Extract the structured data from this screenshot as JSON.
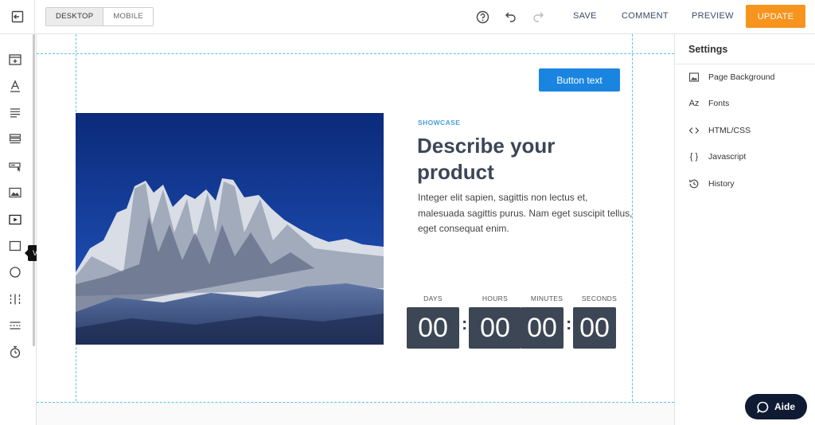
{
  "topbar": {
    "device_desktop": "DESKTOP",
    "device_mobile": "MOBILE",
    "save": "SAVE",
    "comment": "COMMENT",
    "preview": "PREVIEW",
    "update": "UPDATE"
  },
  "leftbar": {
    "tools": [
      "section-add-icon",
      "text-icon",
      "paragraph-icon",
      "list-icon",
      "form-icon",
      "image-icon",
      "video-icon",
      "box-icon",
      "circle-icon",
      "columns-icon",
      "divider-icon",
      "timer-icon"
    ],
    "tooltip": "Video"
  },
  "canvas": {
    "button_text": "Button text",
    "eyebrow": "SHOWCASE",
    "headline": "Describe your product",
    "body": "Integer elit sapien, sagittis non lectus et, malesuada sagittis purus. Nam eget suscipit tellus, eget consequat enim.",
    "countdown": {
      "days_label": "DAYS",
      "hours_label": "HOURS",
      "minutes_label": "MINUTES",
      "seconds_label": "SECONDS",
      "days": "00",
      "hours": "00",
      "minutes": "00",
      "seconds": "00",
      "separator": ":"
    }
  },
  "settings": {
    "title": "Settings",
    "items": [
      "Page Background",
      "Fonts",
      "HTML/CSS",
      "Javascript",
      "History"
    ]
  },
  "help": {
    "label": "Aide"
  },
  "colors": {
    "accent_orange": "#f7941d",
    "button_blue": "#1a85e0",
    "countdown_bg": "#3c4654",
    "guide": "#59c3e6",
    "help_bg": "#0f1b33"
  }
}
